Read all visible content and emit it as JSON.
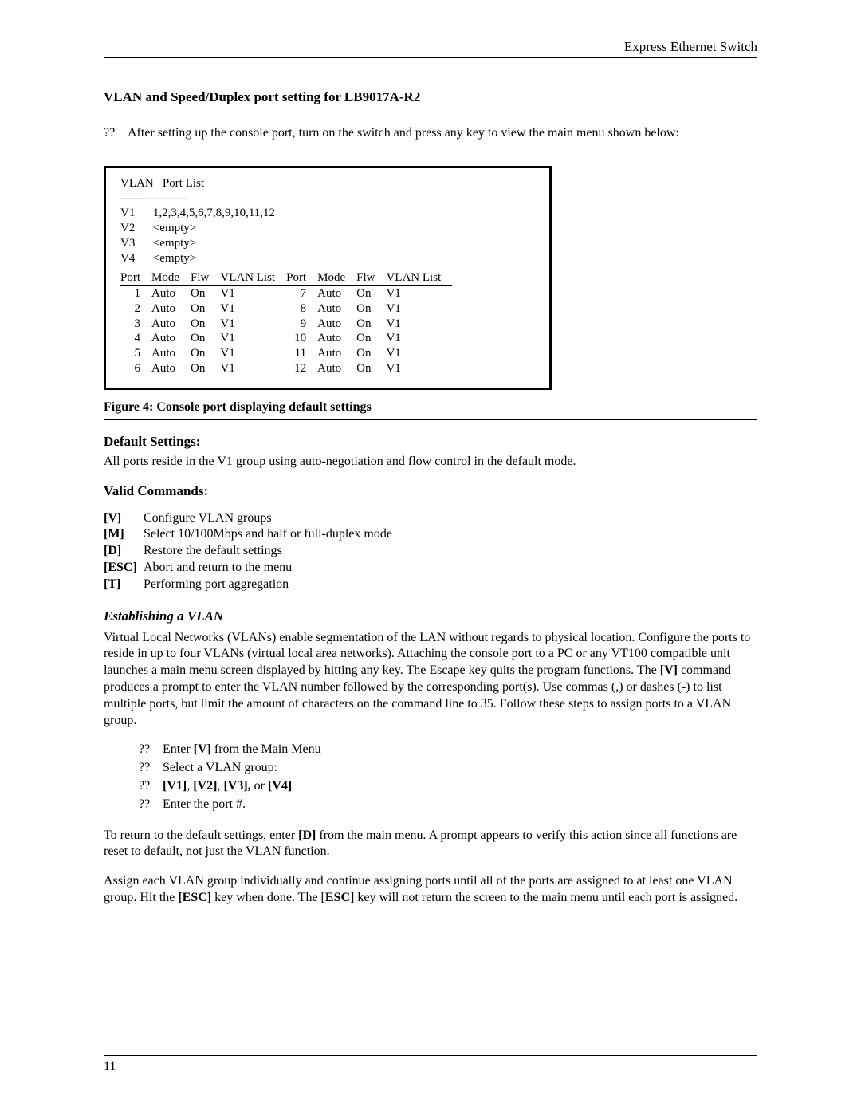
{
  "header": {
    "right": "Express Ethernet Switch"
  },
  "title": "VLAN and Speed/Duplex port setting for LB9017A-R2",
  "intro_q": "??",
  "intro": "After setting up the console port, turn on the switch and press any key to view the main menu shown below:",
  "console": {
    "title": "VLAN   Port List",
    "sep": "-----------------",
    "vlans": [
      {
        "id": "V1",
        "list": "1,2,3,4,5,6,7,8,9,10,11,12"
      },
      {
        "id": "V2",
        "list": "<empty>"
      },
      {
        "id": "V3",
        "list": "<empty>"
      },
      {
        "id": "V4",
        "list": "<empty>"
      }
    ],
    "headers": [
      "Port",
      "Mode",
      "Flw",
      "VLAN List",
      "Port",
      "Mode",
      "Flw",
      "VLAN List"
    ],
    "rows": [
      [
        "1",
        "Auto",
        "On",
        "V1",
        "7",
        "Auto",
        "On",
        "V1"
      ],
      [
        "2",
        "Auto",
        "On",
        "V1",
        "8",
        "Auto",
        "On",
        "V1"
      ],
      [
        "3",
        "Auto",
        "On",
        "V1",
        "9",
        "Auto",
        "On",
        "V1"
      ],
      [
        "4",
        "Auto",
        "On",
        "V1",
        "10",
        "Auto",
        "On",
        "V1"
      ],
      [
        "5",
        "Auto",
        "On",
        "V1",
        "11",
        "Auto",
        "On",
        "V1"
      ],
      [
        "6",
        "Auto",
        "On",
        "V1",
        "12",
        "Auto",
        "On",
        "V1"
      ]
    ]
  },
  "figure_caption": "Figure 4: Console port displaying default settings",
  "default_heading": "Default Settings:",
  "default_text": "All ports reside in the V1 group using auto-negotiation and flow control in the default mode.",
  "valid_heading": "Valid Commands:",
  "commands": [
    {
      "key": "[V]",
      "desc": "Configure VLAN groups"
    },
    {
      "key": "[M]",
      "desc": "Select 10/100Mbps and half or full-duplex mode"
    },
    {
      "key": "[D]",
      "desc": "Restore the default settings"
    },
    {
      "key": "[ESC]",
      "desc": "Abort and return to the menu"
    },
    {
      "key": "[T]",
      "desc": "Performing port aggregation"
    }
  ],
  "est_heading": "Establishing a VLAN",
  "est_para_pre": "Virtual Local Networks (VLANs) enable segmentation of the LAN without regards to physical location. Configure the ports to reside in up to four VLANs (virtual local area networks). Attaching the console port to a PC or any VT100 compatible unit launches a main menu screen displayed by hitting any key. The Escape key quits the program functions. The ",
  "est_para_b1": "[V]",
  "est_para_post": " command produces a prompt to enter the VLAN number followed by the corresponding port(s). Use commas (,) or dashes (-) to list multiple ports, but limit the amount of characters on the command line to 35. Follow these steps to assign ports to a VLAN group.",
  "steps": {
    "q": "??",
    "s1_pre": "Enter ",
    "s1_b": "[V]",
    "s1_post": " from the Main Menu",
    "s2": "Select a VLAN group:",
    "s3_b1": "[V1]",
    "s3_c1": ", ",
    "s3_b2": "[V2]",
    "s3_c2": ", ",
    "s3_b3": "[V3],",
    "s3_or": " or ",
    "s3_b4": "[V4]",
    "s4": "Enter the port #."
  },
  "ret_pre": "To return to the default settings, enter ",
  "ret_b": "[D]",
  "ret_post": " from the main menu. A prompt appears to verify this action since all functions are reset to default, not just the VLAN function.",
  "assign_pre": "Assign each VLAN group individually and continue assigning ports until all of the ports are assigned to at least one VLAN group. Hit the ",
  "assign_b1": "[ESC]",
  "assign_mid": " key when done. The [",
  "assign_b2": "ESC",
  "assign_post": "] key will not return the screen to the main menu until each port is assigned.",
  "page_num": "11"
}
